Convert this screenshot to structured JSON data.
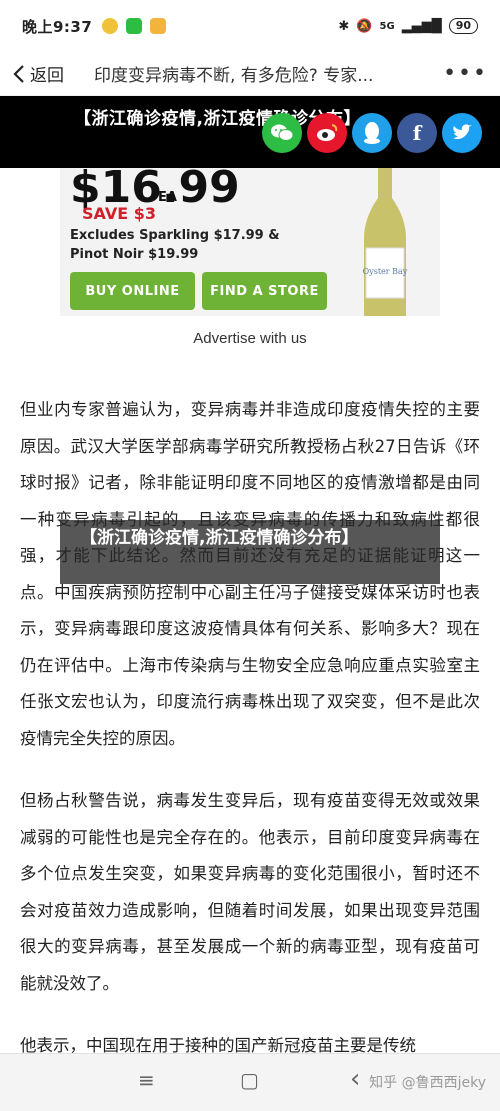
{
  "status": {
    "time": "晚上9:37",
    "network": "5G",
    "battery": "90"
  },
  "nav": {
    "back_label": "返回",
    "title": "印度变异病毒不断, 有多危险? 专家...",
    "more": "•••"
  },
  "banner": {
    "text": "【浙江确诊疫情,浙江疫情确诊分布】"
  },
  "share": [
    {
      "name": "wechat",
      "glyph": "",
      "color": "#2dbc44"
    },
    {
      "name": "weibo",
      "glyph": "",
      "color": "#e6162d"
    },
    {
      "name": "qq",
      "glyph": "",
      "color": "#20a0e8"
    },
    {
      "name": "facebook",
      "glyph": "f",
      "color": "#3b5998"
    },
    {
      "name": "twitter",
      "glyph": "",
      "color": "#1da1f2"
    }
  ],
  "ad": {
    "price": "$16.99",
    "unit": "EA",
    "save": "SAVE $3",
    "line1": "Excludes Sparkling $17.99 &",
    "line2": "Pinot Noir $19.99",
    "buy_label": "BUY ONLINE",
    "store_label": "FIND A STORE",
    "bottle_label": "Oyster Bay"
  },
  "advertise_label": "Advertise with us",
  "article": {
    "paragraphs": [
      "但业内专家普遍认为，变异病毒并非造成印度疫情失控的主要原因。武汉大学医学部病毒学研究所教授杨占秋27日告诉《环球时报》记者，除非能证明印度不同地区的疫情激增都是由同一种变异病毒引起的，且该变异病毒的传播力和致病性都很强，才能下此结论。然而目前还没有充足的证据能证明这一点。中国疾病预防控制中心副主任冯子健接受媒体采访时也表示，变异病毒跟印度这波疫情具体有何关系、影响多大？现在仍在评估中。上海市传染病与生物安全应急响应重点实验室主任张文宏也认为，印度流行病毒株出现了双突变，但不是此次疫情完全失控的原因。",
      "但杨占秋警告说，病毒发生变异后，现有疫苗变得无效或效果减弱的可能性也是完全存在的。他表示，目前印度变异病毒在多个位点发生突变，如果变异病毒的变化范围很小，暂时还不会对疫苗效力造成影响，但随着时间发展，如果出现变异范围很大的变异病毒，甚至发展成一个新的病毒亚型，现有疫苗可能就没效了。",
      "他表示，中国现在用于接种的国产新冠疫苗主要是传统"
    ]
  },
  "overlay": {
    "text": "【浙江确诊疫情,浙江疫情确诊分布】"
  },
  "bottom": {
    "menu": "≡",
    "home": "▢",
    "back": "‹",
    "watermark": "知乎 @鲁西西jeky"
  }
}
